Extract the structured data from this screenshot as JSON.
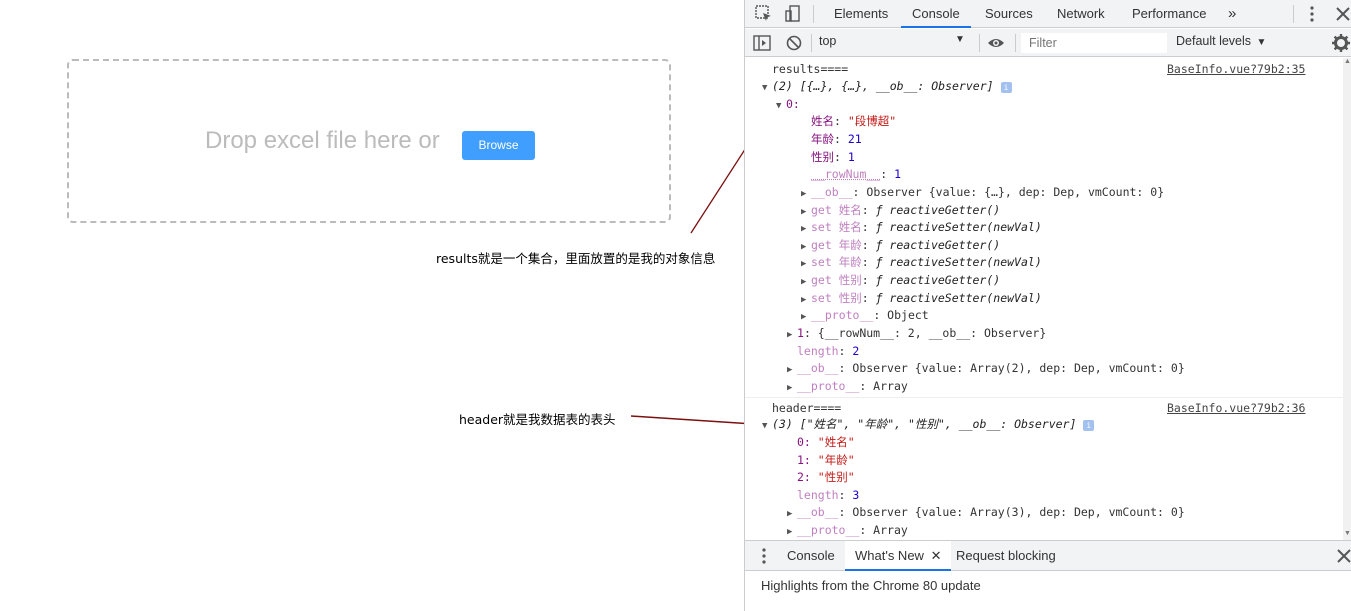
{
  "app": {
    "drop_text": "Drop excel file here or",
    "browse_label": "Browse"
  },
  "annotations": {
    "results_note": "results就是一个集合，里面放置的是我的对象信息",
    "header_note": "header就是我数据表的表头"
  },
  "devtools": {
    "tabs": [
      "Elements",
      "Console",
      "Sources",
      "Network",
      "Performance"
    ],
    "active_tab": "Console",
    "more_tabs": "»",
    "context": "top",
    "filter_placeholder": "Filter",
    "levels": "Default levels",
    "console": {
      "msg1": {
        "label": "results====",
        "source": "BaseInfo.vue?79b2:35",
        "summary": "(2) [{…}, {…}, __ob__: Observer]",
        "item0_key": "0:",
        "fields": [
          {
            "key": "姓名",
            "value": "\"段博超\""
          },
          {
            "key": "年龄",
            "value": "21"
          },
          {
            "key": "性别",
            "value": "1"
          },
          {
            "key": "__rowNum__",
            "value": "1"
          }
        ],
        "ob_line": "Observer {value: {…}, dep: Dep, vmCount: 0}",
        "accessors": [
          {
            "prefix": "get 姓名",
            "fn": "reactiveGetter()"
          },
          {
            "prefix": "set 姓名",
            "fn": "reactiveSetter(newVal)"
          },
          {
            "prefix": "get 年龄",
            "fn": "reactiveGetter()"
          },
          {
            "prefix": "set 年龄",
            "fn": "reactiveSetter(newVal)"
          },
          {
            "prefix": "get 性别",
            "fn": "reactiveGetter()"
          },
          {
            "prefix": "set 性别",
            "fn": "reactiveSetter(newVal)"
          }
        ],
        "proto_obj": "Object",
        "item1": "{__rowNum__: 2, __ob__: Observer}",
        "length": "2",
        "ob_array": "Observer {value: Array(2), dep: Dep, vmCount: 0}",
        "proto_arr": "Array"
      },
      "msg2": {
        "label": "header====",
        "source": "BaseInfo.vue?79b2:36",
        "summary": "(3) [\"姓名\", \"年龄\", \"性别\", __ob__: Observer]",
        "items": [
          {
            "key": "0:",
            "value": "\"姓名\""
          },
          {
            "key": "1:",
            "value": "\"年龄\""
          },
          {
            "key": "2:",
            "value": "\"性别\""
          }
        ],
        "length": "3",
        "ob_array": "Observer {value: Array(3), dep: Dep, vmCount: 0}",
        "proto_arr": "Array"
      }
    },
    "drawer": {
      "tabs": [
        "Console",
        "What's New",
        "Request blocking"
      ],
      "active_tab": "What's New",
      "content": "Highlights from the Chrome 80 update"
    }
  },
  "colors": {
    "accent": "#1a73e8",
    "browse": "#409eff",
    "arrow": "#7b1010"
  }
}
